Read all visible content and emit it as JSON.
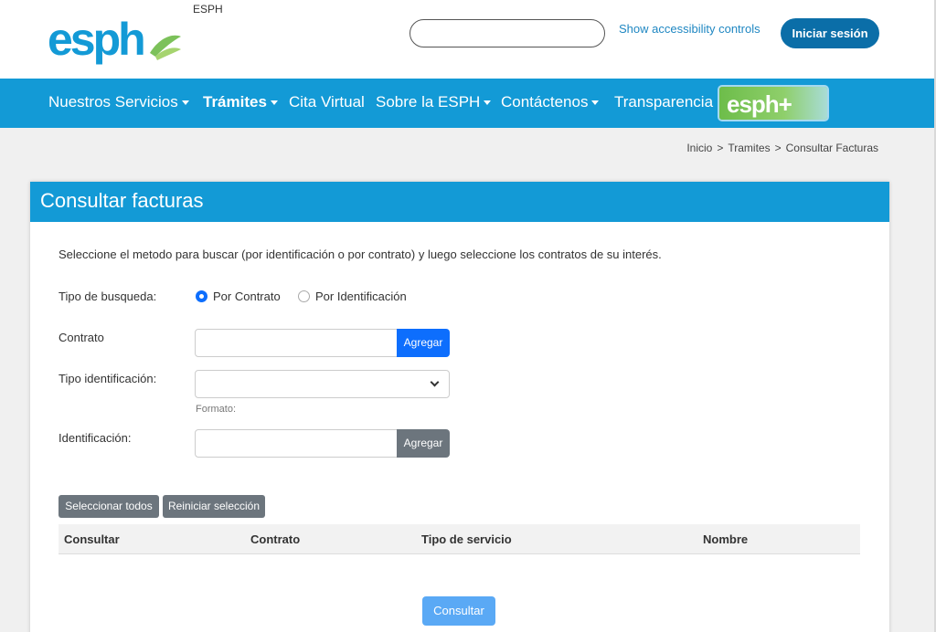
{
  "header": {
    "site_name": "ESPH",
    "logo_alt": "esph",
    "search": {
      "value": "",
      "placeholder": ""
    },
    "accessibility_link": "Show accessibility controls",
    "login_button": "Iniciar sesión"
  },
  "nav": {
    "items": [
      {
        "label": "Nuestros Servicios",
        "has_dropdown": true
      },
      {
        "label": "Trámites",
        "has_dropdown": true,
        "active": true
      },
      {
        "label": "Cita Virtual",
        "has_dropdown": false
      },
      {
        "label": "Sobre la ESPH",
        "has_dropdown": true
      },
      {
        "label": "Contáctenos",
        "has_dropdown": true
      },
      {
        "label": "Transparencia",
        "has_dropdown": false
      }
    ],
    "esph_plus_logo": "esph+"
  },
  "breadcrumb": {
    "items": [
      "Inicio",
      "Tramites",
      "Consultar Facturas"
    ],
    "separator": ">"
  },
  "card": {
    "title": "Consultar facturas",
    "intro": "Seleccione el metodo para buscar (por identificación o por contrato) y luego seleccione los contratos de su interés.",
    "search_type": {
      "label": "Tipo de busqueda:",
      "options": [
        "Por Contrato",
        "Por Identificación"
      ],
      "selected": "Por Contrato"
    },
    "contract": {
      "label": "Contrato",
      "value": "",
      "add_button": "Agregar"
    },
    "id_type": {
      "label": "Tipo identificación:",
      "value": "",
      "format_hint": "Formato:"
    },
    "identification": {
      "label": "Identificación:",
      "value": "",
      "add_button": "Agregar"
    },
    "select_all_button": "Seleccionar todos",
    "reset_button": "Reiniciar selección",
    "table": {
      "columns": [
        "Consultar",
        "Contrato",
        "Tipo de servicio",
        "Nombre"
      ],
      "rows": []
    },
    "submit_button": "Consultar"
  },
  "colors": {
    "brand_blue": "#139ad6",
    "primary": "#0d6efd",
    "login_blue": "#0b6ea8",
    "gray_button": "#6c757d",
    "brand_green": "#7cc15a"
  }
}
